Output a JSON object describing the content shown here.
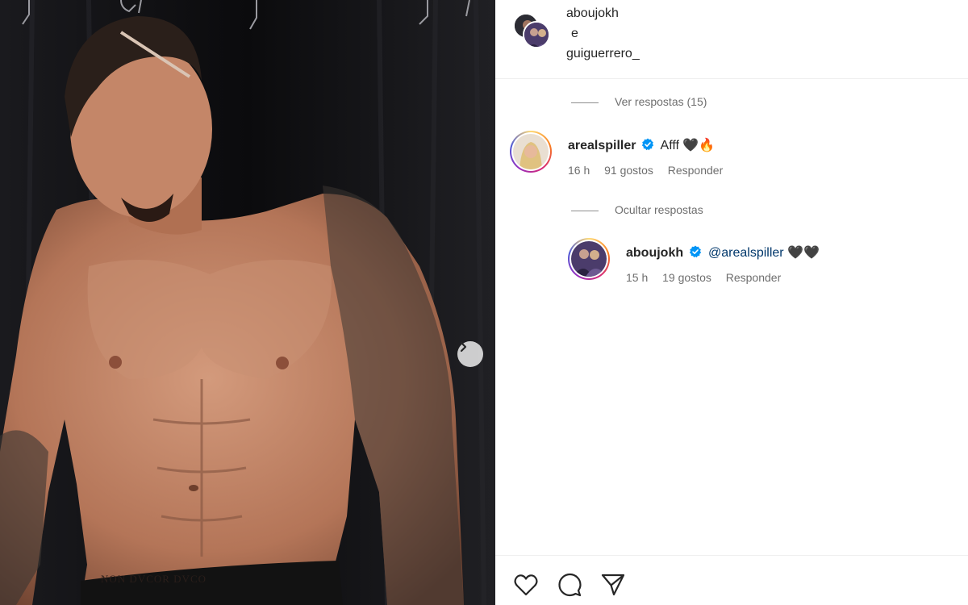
{
  "header": {
    "user1": "aboujokh",
    "conjunction": "e",
    "user2": "guiguerrero_"
  },
  "thread": {
    "view_replies": "Ver respostas (15)",
    "hide_replies": "Ocultar respostas"
  },
  "comments": [
    {
      "username": "arealspiller",
      "verified": true,
      "text": "Afff 🖤🔥",
      "time": "16 h",
      "likes": "91 gostos",
      "reply": "Responder"
    },
    {
      "username": "aboujokh",
      "verified": true,
      "mention": "@arealspiller",
      "text": "🖤🖤",
      "time": "15 h",
      "likes": "19 gostos",
      "reply": "Responder"
    }
  ],
  "media": {
    "tattoo_text": "NON DVCOR DVCO"
  },
  "icons": {
    "like": "heart-icon",
    "comment": "comment-bubble-icon",
    "share": "paper-plane-icon",
    "next": "chevron-right-icon",
    "verified": "verified-badge-icon"
  },
  "colors": {
    "verified": "#0095f6",
    "mention": "#00376b",
    "secondary_text": "#6e6e6e",
    "text": "#262626"
  }
}
